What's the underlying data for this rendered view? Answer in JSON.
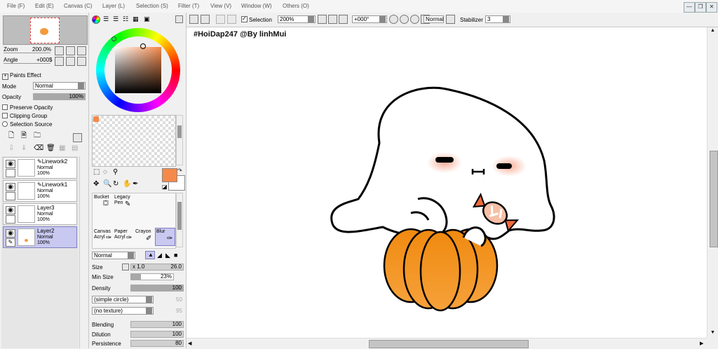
{
  "menu": [
    {
      "label": "File (F)"
    },
    {
      "label": "Edit (E)"
    },
    {
      "label": "Canvas (C)"
    },
    {
      "label": "Layer (L)"
    },
    {
      "label": "Selection (S)"
    },
    {
      "label": "Filter (T)"
    },
    {
      "label": "View (V)"
    },
    {
      "label": "Window (W)"
    },
    {
      "label": "Others (O)"
    }
  ],
  "window_controls": {
    "minimize": "—",
    "restore": "❐",
    "close": "✕"
  },
  "navigator": {
    "zoom_label": "Zoom",
    "zoom_value": "200.0%",
    "angle_label": "Angle",
    "angle_value": "+000$"
  },
  "paints_effect": {
    "title": "Paints Effect",
    "mode_label": "Mode",
    "mode_value": "Normal",
    "opacity_label": "Opacity",
    "opacity_value": "100%",
    "opacity_fraction": 1.0,
    "preserve_opacity": "Preserve Opacity",
    "clipping_group": "Clipping Group",
    "selection_source": "Selection Source"
  },
  "layers": [
    {
      "name": "Linework2",
      "mode": "Normal",
      "opacity": "100%",
      "selected": false
    },
    {
      "name": "Linework1",
      "mode": "Normal",
      "opacity": "100%",
      "selected": false
    },
    {
      "name": "Layer3",
      "mode": "Normal",
      "opacity": "100%",
      "selected": false
    },
    {
      "name": "Layer2",
      "mode": "Normal",
      "opacity": "100%",
      "selected": true
    }
  ],
  "colors": {
    "primary": "#f5894a",
    "secondary": "#ffffff",
    "swatch": "#f5894a",
    "selection_highlight": "#c8c8f0"
  },
  "tools": [
    {
      "name": "Bucket",
      "sub": ""
    },
    {
      "name": "Legacy",
      "sub": "Pen"
    },
    {
      "name": "Canvas",
      "sub": "Acryl"
    },
    {
      "name": "Paper",
      "sub": "Acryl"
    },
    {
      "name": "Crayon",
      "sub": ""
    },
    {
      "name": "Blur",
      "sub": "",
      "selected": true
    }
  ],
  "brush": {
    "blend_mode": "Normal",
    "size_label": "Size",
    "size_mult": "x 1.0",
    "size_value": "26.0",
    "min_size_label": "Min Size",
    "min_size_value": "23%",
    "min_size_fraction": 0.23,
    "density_label": "Density",
    "density_value": "100",
    "density_fraction": 1.0,
    "shape": "(simple circle)",
    "shape_value": "50",
    "texture": "(no texture)",
    "texture_value": "95",
    "blending_label": "Blending",
    "blending_value": "100",
    "dilution_label": "Dilution",
    "dilution_value": "100",
    "persistence_label": "Persistence",
    "persistence_value": "80"
  },
  "toolbar": {
    "selection_label": "Selection",
    "zoom_value": "200%",
    "angle_value": "+000°",
    "mode_value": "Normal",
    "stabilizer_label": "Stabilizer",
    "stabilizer_value": "3"
  },
  "canvas": {
    "watermark": "#HoiDap247 @By linhMui"
  }
}
